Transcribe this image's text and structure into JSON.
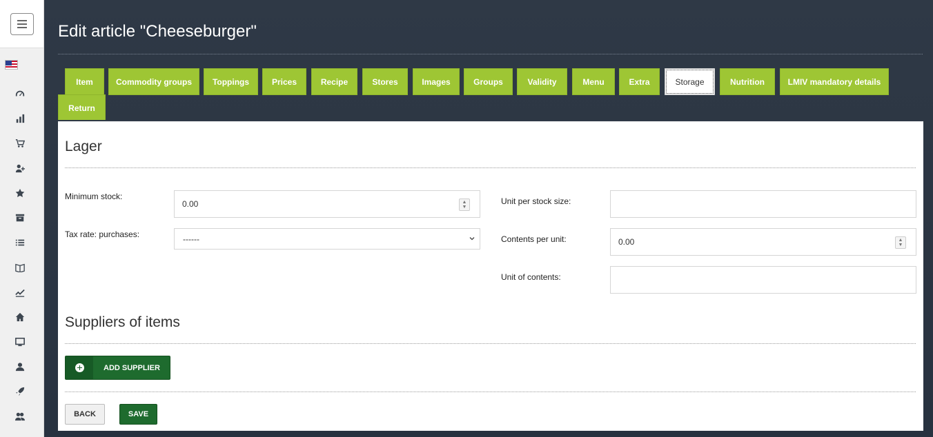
{
  "page": {
    "title": "Edit article \"Cheeseburger\""
  },
  "tabs": [
    {
      "label": "Item"
    },
    {
      "label": "Commodity groups"
    },
    {
      "label": "Toppings"
    },
    {
      "label": "Prices"
    },
    {
      "label": "Recipe"
    },
    {
      "label": "Stores"
    },
    {
      "label": "Images"
    },
    {
      "label": "Groups"
    },
    {
      "label": "Validity"
    },
    {
      "label": "Menu"
    },
    {
      "label": "Extra"
    },
    {
      "label": "Storage",
      "active": true
    },
    {
      "label": "Nutrition"
    },
    {
      "label": "LMIV mandatory details"
    },
    {
      "label": "Return"
    }
  ],
  "storage": {
    "section_title": "Lager",
    "minimum_stock_label": "Minimum stock:",
    "minimum_stock_value": "0.00",
    "tax_rate_label": "Tax rate: purchases:",
    "tax_rate_value": "------",
    "unit_per_stock_size_label": "Unit per stock size:",
    "unit_per_stock_size_value": "",
    "contents_per_unit_label": "Contents per unit:",
    "contents_per_unit_value": "0.00",
    "unit_of_contents_label": "Unit of contents:",
    "unit_of_contents_value": ""
  },
  "suppliers": {
    "section_title": "Suppliers of items",
    "add_button_label": "ADD SUPPLIER"
  },
  "actions": {
    "back_label": "BACK",
    "save_label": "SAVE"
  },
  "sidebar": {
    "icons": [
      "dashboard-icon",
      "bar-chart-icon",
      "cart-icon",
      "add-user-icon",
      "star-icon",
      "archive-icon",
      "list-icon",
      "book-icon",
      "trend-icon",
      "home-icon",
      "monitor-icon",
      "user-icon",
      "rocket-icon",
      "users-icon"
    ]
  },
  "colors": {
    "tab_green": "#9ec634",
    "button_dark_green": "#1e6b2e",
    "header_bg": "#2f3946"
  }
}
